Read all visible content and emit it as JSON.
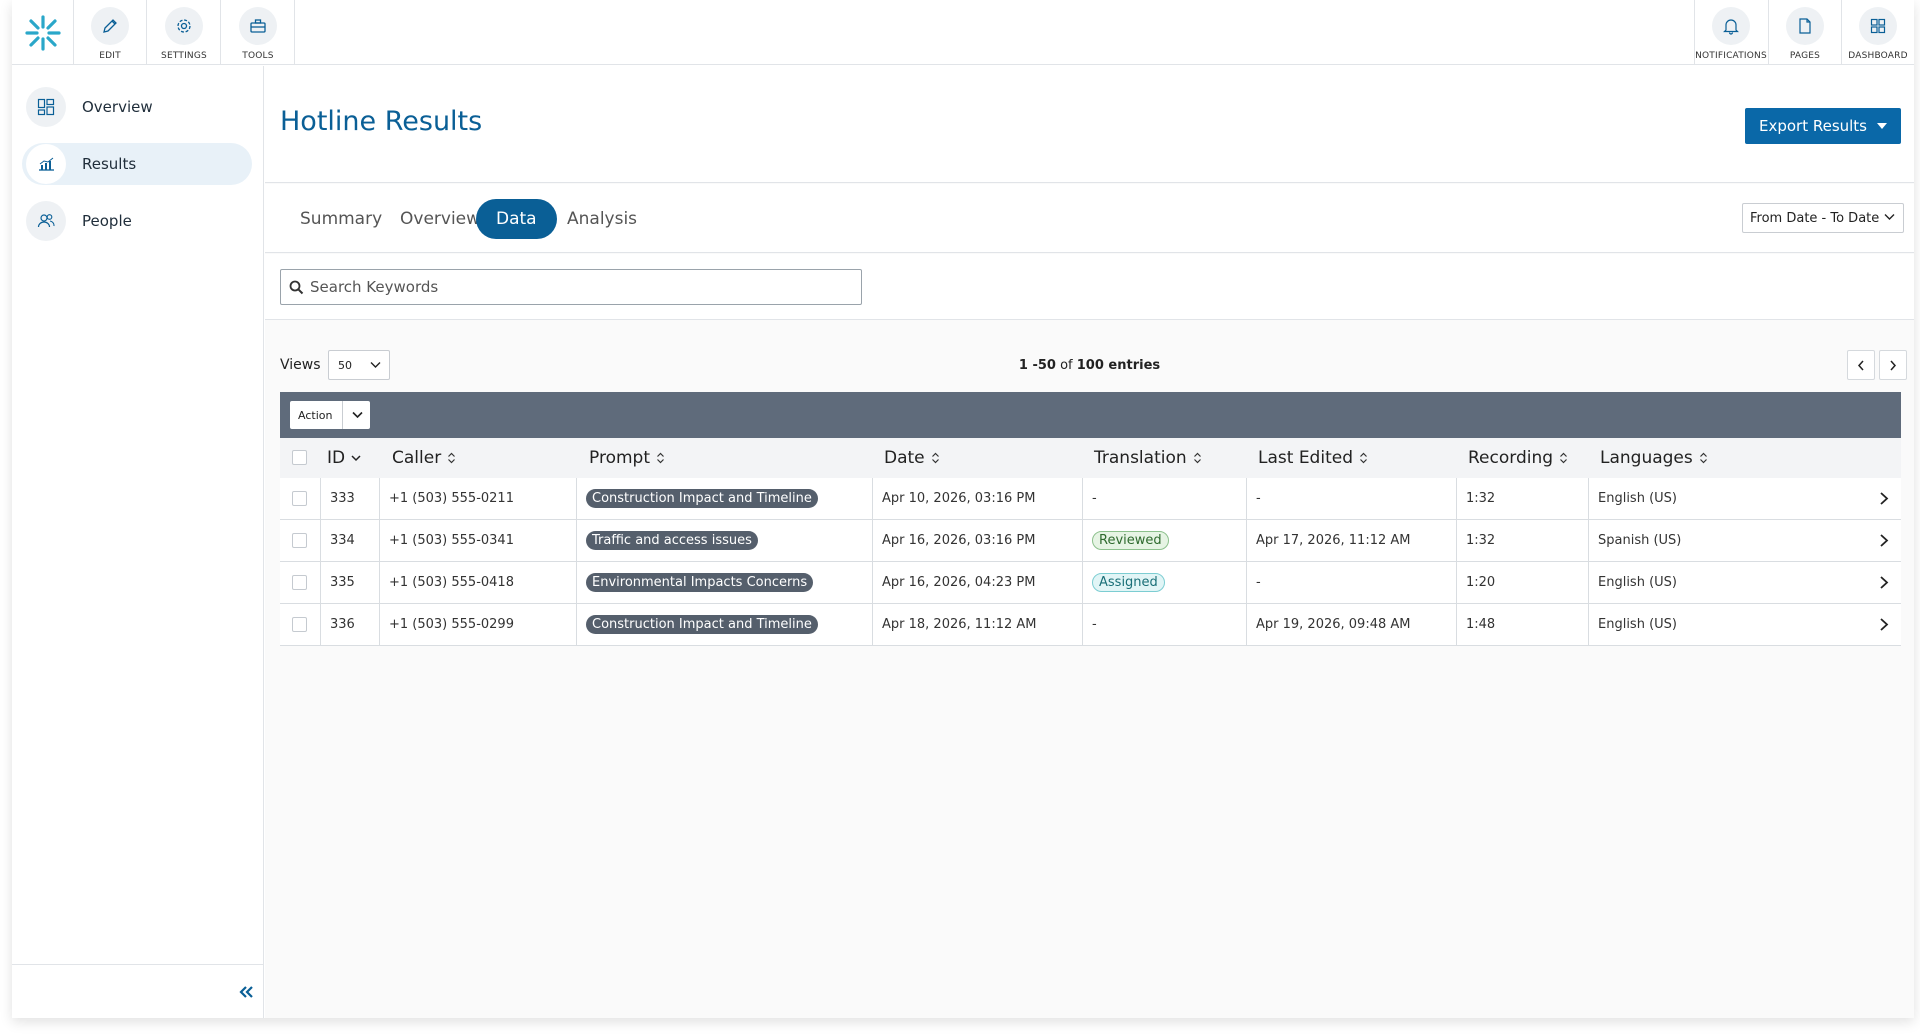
{
  "toolbar": {
    "left": [
      {
        "id": "edit",
        "label": "EDIT",
        "icon": "pencil-icon"
      },
      {
        "id": "settings",
        "label": "SETTINGS",
        "icon": "gear-icon"
      },
      {
        "id": "tools",
        "label": "TOOLS",
        "icon": "toolbox-icon"
      }
    ],
    "right": [
      {
        "id": "notifications",
        "label": "NOTIFICATIONS",
        "icon": "bell-icon"
      },
      {
        "id": "pages",
        "label": "PAGES",
        "icon": "page-icon"
      },
      {
        "id": "dashboard",
        "label": "DASHBOARD",
        "icon": "grid-icon"
      }
    ]
  },
  "sidebar": {
    "items": [
      {
        "label": "Overview",
        "icon": "layout-icon",
        "active": false
      },
      {
        "label": "Results",
        "icon": "chart-icon",
        "active": true
      },
      {
        "label": "People",
        "icon": "people-icon",
        "active": false
      }
    ],
    "collapse_icon": "double-chevron-left-icon"
  },
  "header": {
    "title": "Hotline Results",
    "export_label": "Export Results"
  },
  "tabs": [
    {
      "label": "Summary",
      "active": false
    },
    {
      "label": "Overview",
      "active": false
    },
    {
      "label": "Data",
      "active": true
    },
    {
      "label": "Analysis",
      "active": false
    }
  ],
  "date_range": "From Date - To Date",
  "search": {
    "placeholder": "Search Keywords",
    "value": ""
  },
  "views": {
    "label": "Views",
    "value": "50"
  },
  "entries": {
    "range": "1 -50",
    "of": "of",
    "total": "100 entries"
  },
  "action": {
    "label": "Action"
  },
  "table": {
    "columns": [
      "ID",
      "Caller",
      "Prompt",
      "Date",
      "Translation",
      "Last Edited",
      "Recording",
      "Languages"
    ],
    "rows": [
      {
        "id": "333",
        "caller": "+1 (503) 555-0211",
        "prompt": "Construction Impact and Timeline",
        "date": "Apr 10, 2026, 03:16 PM",
        "translation": "-",
        "translation_status": "none",
        "last_edited": "-",
        "recording": "1:32",
        "language": "English (US)"
      },
      {
        "id": "334",
        "caller": "+1 (503) 555-0341",
        "prompt": "Traffic and access issues",
        "date": "Apr 16, 2026, 03:16 PM",
        "translation": "Reviewed",
        "translation_status": "reviewed",
        "last_edited": "Apr 17, 2026, 11:12 AM",
        "recording": "1:32",
        "language": "Spanish (US)"
      },
      {
        "id": "335",
        "caller": "+1 (503) 555-0418",
        "prompt": "Environmental Impacts Concerns",
        "date": "Apr 16, 2026, 04:23 PM",
        "translation": "Assigned",
        "translation_status": "assigned",
        "last_edited": "-",
        "recording": "1:20",
        "language": "English (US)"
      },
      {
        "id": "336",
        "caller": "+1 (503) 555-0299",
        "prompt": "Construction Impact and Timeline",
        "date": "Apr 18, 2026, 11:12 AM",
        "translation": "-",
        "translation_status": "none",
        "last_edited": "Apr 19, 2026, 09:48 AM",
        "recording": "1:48",
        "language": "English (US)"
      }
    ]
  },
  "colors": {
    "brand": "#0a5f96",
    "accent": "#0a68a8",
    "logo": "#2aa7c9",
    "action_bar": "#5f6b7b"
  }
}
